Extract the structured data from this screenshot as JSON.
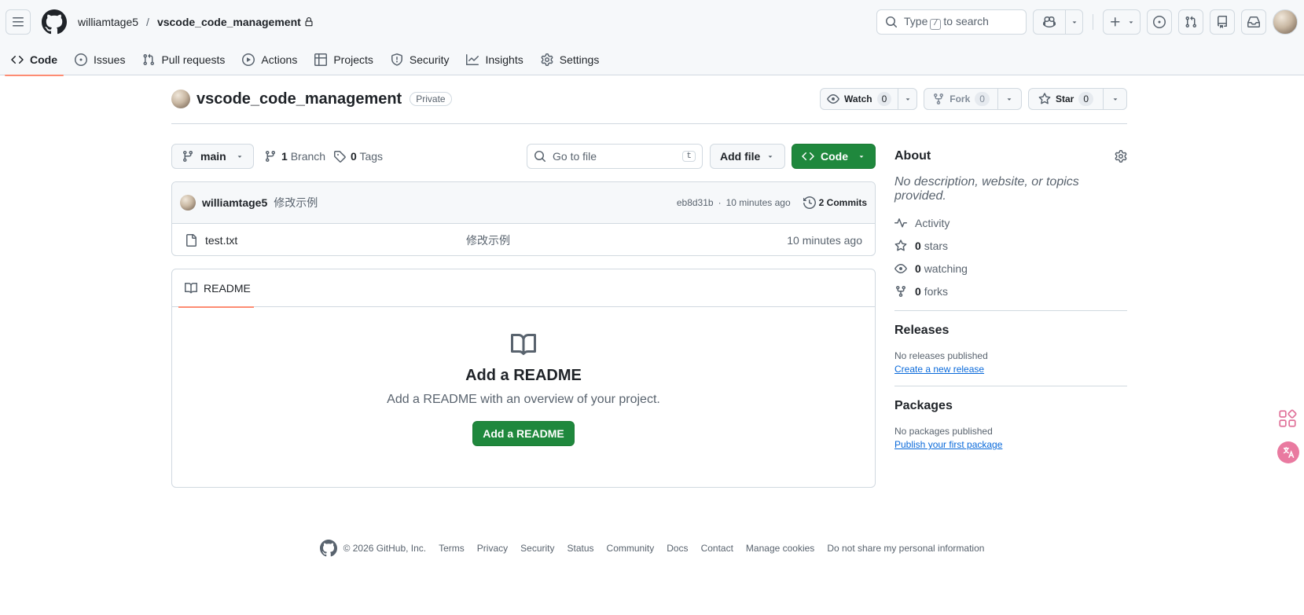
{
  "header": {
    "owner": "williamtage5",
    "separator": "/",
    "repo": "vscode_code_management",
    "search_prefix": "Type",
    "search_key": "/",
    "search_suffix": "to search"
  },
  "tabs": [
    {
      "label": "Code",
      "icon": "code-icon"
    },
    {
      "label": "Issues",
      "icon": "issue-icon"
    },
    {
      "label": "Pull requests",
      "icon": "pull-request-icon"
    },
    {
      "label": "Actions",
      "icon": "play-icon"
    },
    {
      "label": "Projects",
      "icon": "table-icon"
    },
    {
      "label": "Security",
      "icon": "shield-icon"
    },
    {
      "label": "Insights",
      "icon": "graph-icon"
    },
    {
      "label": "Settings",
      "icon": "gear-icon"
    }
  ],
  "repo_header": {
    "name": "vscode_code_management",
    "visibility": "Private",
    "watch_label": "Watch",
    "watch_count": "0",
    "fork_label": "Fork",
    "fork_count": "0",
    "star_label": "Star",
    "star_count": "0"
  },
  "file_nav": {
    "branch": "main",
    "branch_count": "1",
    "branch_label": "Branch",
    "tag_count": "0",
    "tag_label": "Tags",
    "goto_placeholder": "Go to file",
    "goto_key": "t",
    "add_file": "Add file",
    "code": "Code"
  },
  "latest_commit": {
    "author": "williamtage5",
    "message": "修改示例",
    "hash": "eb8d31b",
    "dot": "·",
    "age": "10 minutes ago",
    "commits_label": "2 Commits"
  },
  "files": [
    {
      "name": "test.txt",
      "message": "修改示例",
      "age": "10 minutes ago"
    }
  ],
  "readme": {
    "tab": "README",
    "title": "Add a README",
    "description": "Add a README with an overview of your project.",
    "button": "Add a README"
  },
  "about": {
    "title": "About",
    "description": "No description, website, or topics provided.",
    "activity": "Activity",
    "stars_count": "0",
    "stars_label": "stars",
    "watching_count": "0",
    "watching_label": "watching",
    "forks_count": "0",
    "forks_label": "forks"
  },
  "releases": {
    "title": "Releases",
    "empty": "No releases published",
    "link": "Create a new release"
  },
  "packages": {
    "title": "Packages",
    "empty": "No packages published",
    "link": "Publish your first package"
  },
  "footer": {
    "copyright": "© 2026 GitHub, Inc.",
    "links": [
      "Terms",
      "Privacy",
      "Security",
      "Status",
      "Community",
      "Docs",
      "Contact",
      "Manage cookies",
      "Do not share my personal information"
    ]
  },
  "colors": {
    "accent_green": "#1f883d",
    "tab_underline": "#fd8c73",
    "link_blue": "#0969da"
  }
}
